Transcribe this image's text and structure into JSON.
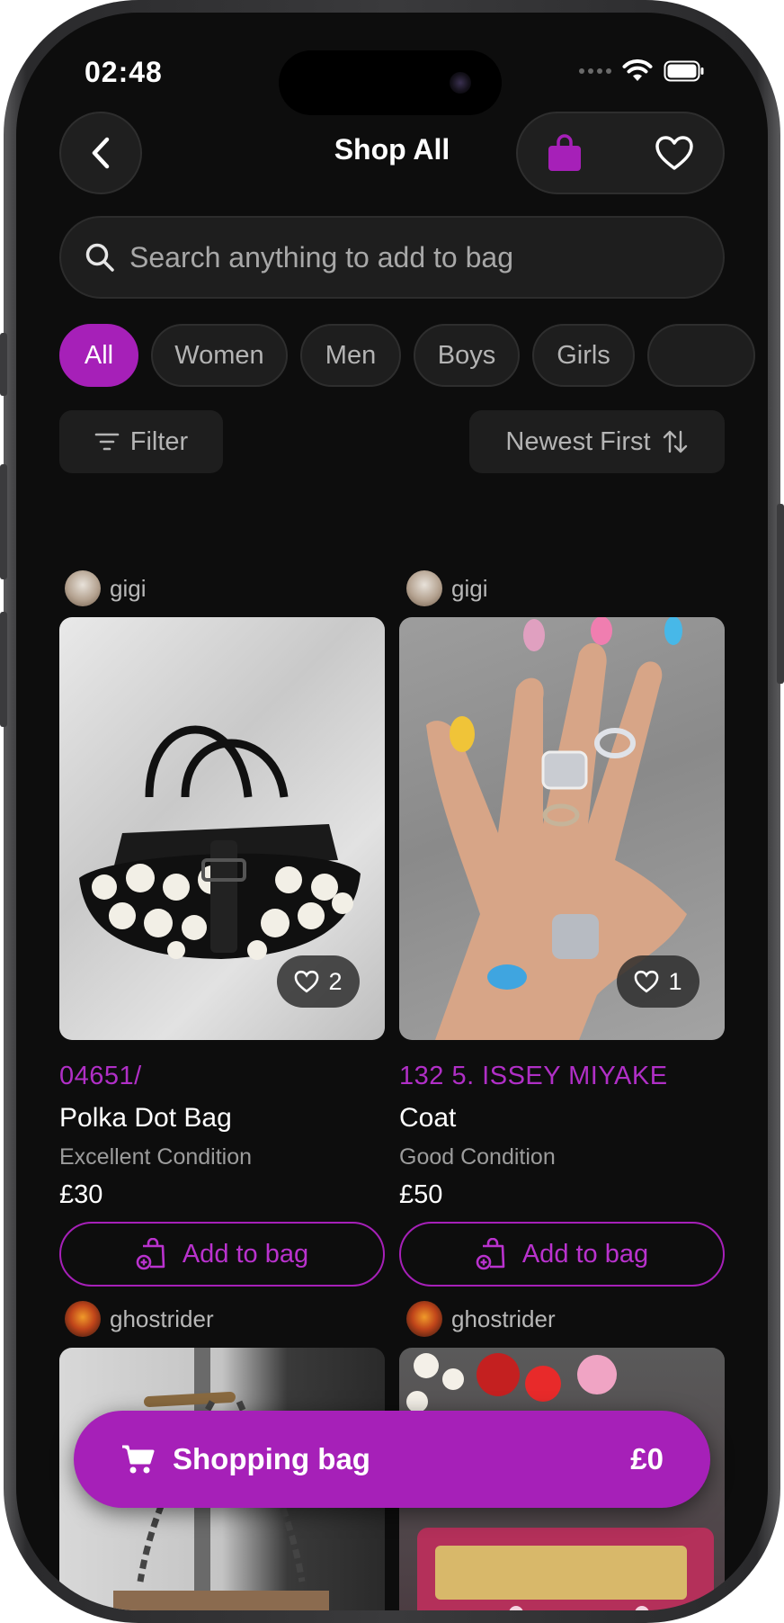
{
  "status_bar": {
    "time": "02:48"
  },
  "header": {
    "title": "Shop All"
  },
  "search": {
    "placeholder": "Search anything to add to bag"
  },
  "categories": [
    "All",
    "Women",
    "Men",
    "Boys",
    "Girls"
  ],
  "active_category": "All",
  "filter": {
    "label": "Filter"
  },
  "sort": {
    "label": "Newest First"
  },
  "products": [
    {
      "seller": "gigi",
      "brand": "04651/",
      "title": "Polka Dot Bag",
      "condition": "Excellent Condition",
      "price": "£30",
      "likes": "2",
      "add_label": "Add to bag"
    },
    {
      "seller": "gigi",
      "brand": "132 5. ISSEY MIYAKE",
      "title": "Coat",
      "condition": "Good Condition",
      "price": "£50",
      "likes": "1",
      "add_label": "Add to bag"
    },
    {
      "seller": "ghostrider"
    },
    {
      "seller": "ghostrider"
    }
  ],
  "bag_bar": {
    "label": "Shopping bag",
    "total": "£0"
  },
  "colors": {
    "accent": "#a620b8",
    "background": "#0d0d0d",
    "surface": "#1e1e1e"
  }
}
